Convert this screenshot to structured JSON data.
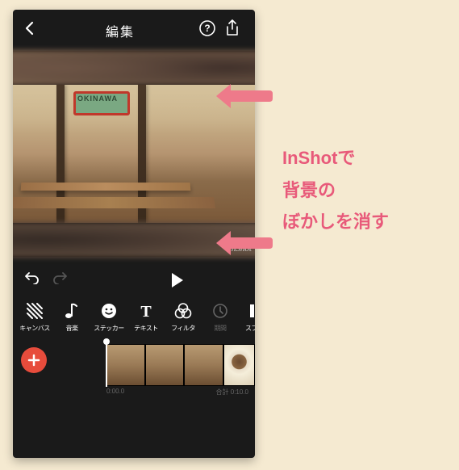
{
  "header": {
    "title": "編集"
  },
  "watermark": "InShot",
  "tools": [
    {
      "label": "キャンバス",
      "icon": "canvas"
    },
    {
      "label": "音楽",
      "icon": "music"
    },
    {
      "label": "ステッカー",
      "icon": "sticker"
    },
    {
      "label": "テキスト",
      "icon": "text"
    },
    {
      "label": "フィルタ",
      "icon": "filter"
    },
    {
      "label": "期間",
      "icon": "duration",
      "dim": true
    },
    {
      "label": "スプリッ",
      "icon": "split"
    }
  ],
  "timeline": {
    "start": "0:00.0",
    "end": "合計 0:10.0"
  },
  "annotation": {
    "line1": "InShotで",
    "line2": "背景の",
    "line3": "ぼかしを消す"
  }
}
